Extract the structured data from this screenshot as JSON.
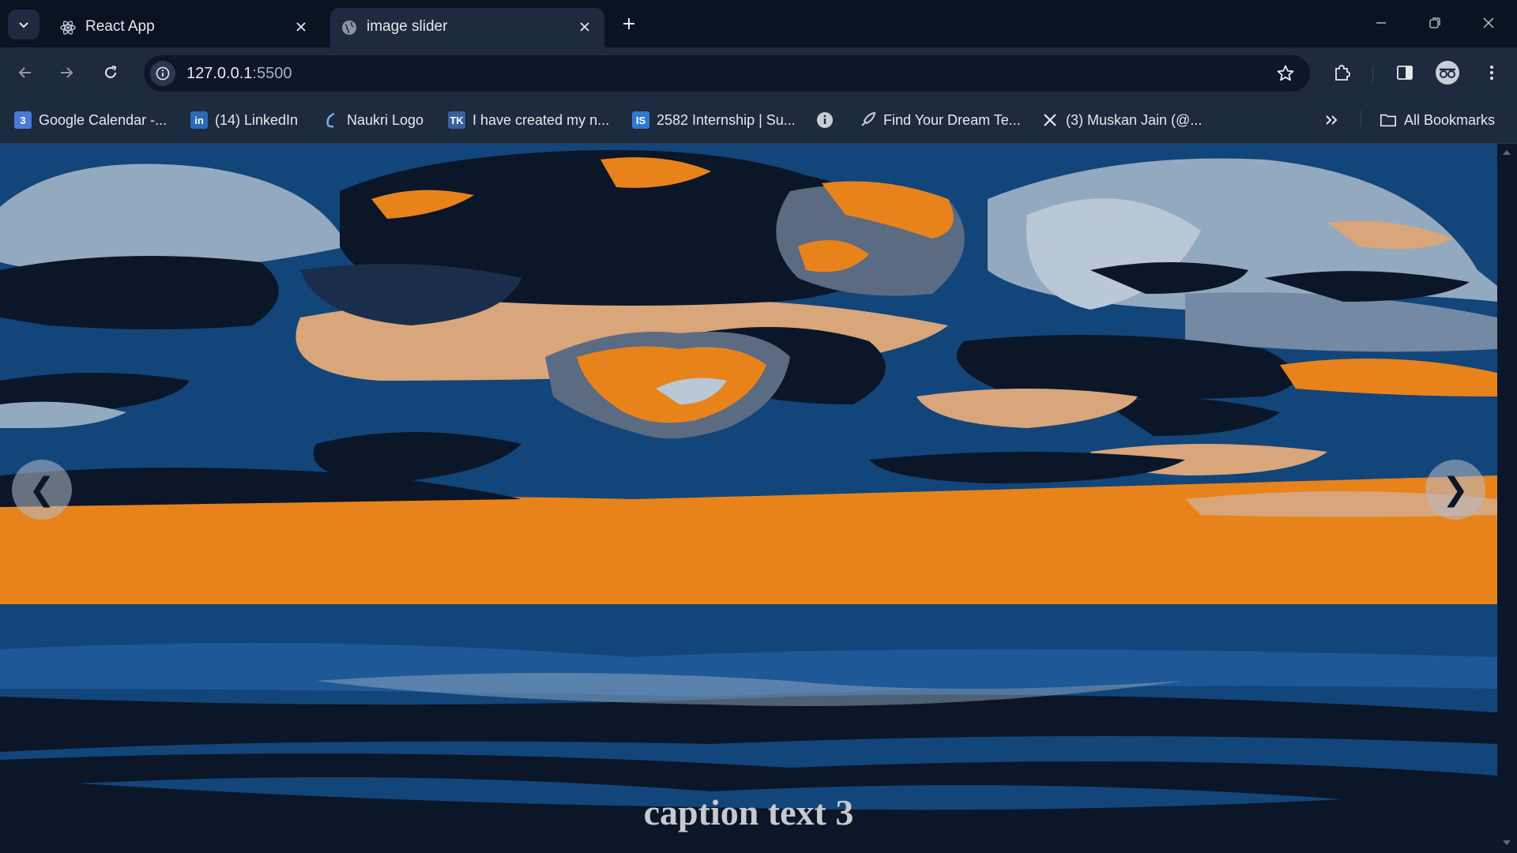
{
  "browser": {
    "tabs": [
      {
        "title": "React App",
        "active": false
      },
      {
        "title": "image slider",
        "active": true
      }
    ],
    "address": {
      "host": "127.0.0.1",
      "port": ":5500"
    },
    "bookmarks": [
      {
        "label": "Google Calendar -...",
        "icon": "calendar-icon"
      },
      {
        "label": "(14) LinkedIn",
        "icon": "linkedin-icon"
      },
      {
        "label": "Naukri Logo",
        "icon": "naukri-icon"
      },
      {
        "label": "I have created my n...",
        "icon": "bookmark-page-icon"
      },
      {
        "label": "2582 Internship | Su...",
        "icon": "internshala-icon"
      },
      {
        "label": "",
        "icon": "info-icon"
      },
      {
        "label": "Find Your Dream Te...",
        "icon": "rocket-icon"
      },
      {
        "label": "(3) Muskan Jain (@...",
        "icon": "x-logo-icon"
      }
    ],
    "all_bookmarks_label": "All Bookmarks"
  },
  "slider": {
    "prev_symbol": "❮",
    "next_symbol": "❯",
    "caption": "caption text 3"
  },
  "colors": {
    "accent_orange": "#e8831c",
    "sea_blue": "#12457a",
    "sky_light": "#93a9c0",
    "sky_dark": "#0b1628"
  }
}
